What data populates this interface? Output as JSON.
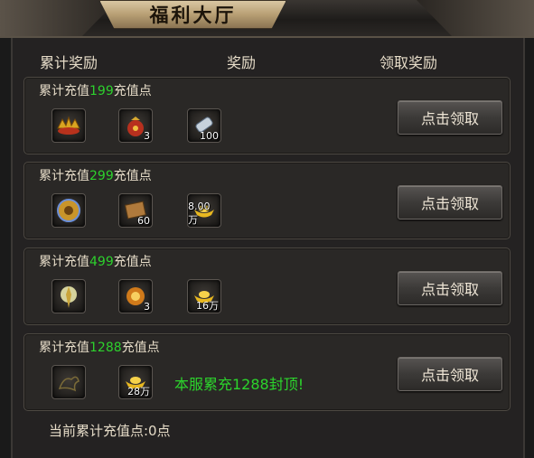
{
  "window": {
    "title": "福利大厅"
  },
  "columns": {
    "cumulative": "累计奖励",
    "rewards": "奖励",
    "claim": "领取奖励"
  },
  "tiers": [
    {
      "prefix": "累计充值",
      "amount": "199",
      "suffix": "充值点",
      "items": [
        {
          "icon": "golden-crown-icon",
          "count": ""
        },
        {
          "icon": "treasure-bag-icon",
          "count": "3"
        },
        {
          "icon": "scroll-icon",
          "count": "100"
        }
      ],
      "button": "点击领取"
    },
    {
      "prefix": "累计充值",
      "amount": "299",
      "suffix": "充值点",
      "items": [
        {
          "icon": "golden-shield-icon",
          "count": ""
        },
        {
          "icon": "parchment-icon",
          "count": "60"
        },
        {
          "icon": "gold-ingot-icon",
          "count": "8.00万"
        }
      ],
      "button": "点击领取"
    },
    {
      "prefix": "累计充值",
      "amount": "499",
      "suffix": "充值点",
      "items": [
        {
          "icon": "glowing-emblem-icon",
          "count": ""
        },
        {
          "icon": "fire-orb-icon",
          "count": "3"
        },
        {
          "icon": "gold-ingot-icon",
          "count": "16万"
        }
      ],
      "button": "点击领取"
    },
    {
      "prefix": "累计充值",
      "amount": "1288",
      "suffix": "充值点",
      "items": [
        {
          "icon": "dragon-silhouette-icon",
          "count": ""
        },
        {
          "icon": "gold-ingot-icon",
          "count": "28万"
        }
      ],
      "notice": "本服累充1288封顶!",
      "button": "点击领取"
    }
  ],
  "footer": {
    "label": "当前累计充值点:0点"
  },
  "colors": {
    "highlight": "#2dd12d",
    "text": "#e6dcc8"
  }
}
